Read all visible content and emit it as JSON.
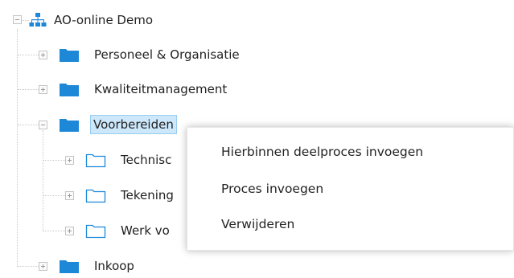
{
  "tree": {
    "root": {
      "label": "AO-online Demo",
      "icon": "org-chart-icon"
    },
    "items": [
      {
        "label": "Personeel & Organisatie",
        "icon": "folder-filled-icon",
        "expanded": false
      },
      {
        "label": "Kwaliteitmanagement",
        "icon": "folder-filled-icon",
        "expanded": false
      },
      {
        "label": "Voorbereiden",
        "icon": "folder-filled-icon",
        "expanded": true,
        "selected": true,
        "children": [
          {
            "label": "Technisc",
            "icon": "folder-outline-icon",
            "expanded": false
          },
          {
            "label": "Tekening",
            "icon": "folder-outline-icon",
            "expanded": false
          },
          {
            "label": "Werk vo",
            "icon": "folder-outline-icon",
            "expanded": false
          }
        ]
      },
      {
        "label": "Inkoop",
        "icon": "folder-filled-icon",
        "expanded": false
      }
    ]
  },
  "context_menu": {
    "items": [
      {
        "label": "Hierbinnen deelproces invoegen"
      },
      {
        "label": "Proces invoegen"
      },
      {
        "label": "Verwijderen"
      }
    ]
  },
  "colors": {
    "folder_fill": "#1e88d8",
    "selection_bg": "#cde8fb",
    "selection_border": "#99cdef"
  }
}
